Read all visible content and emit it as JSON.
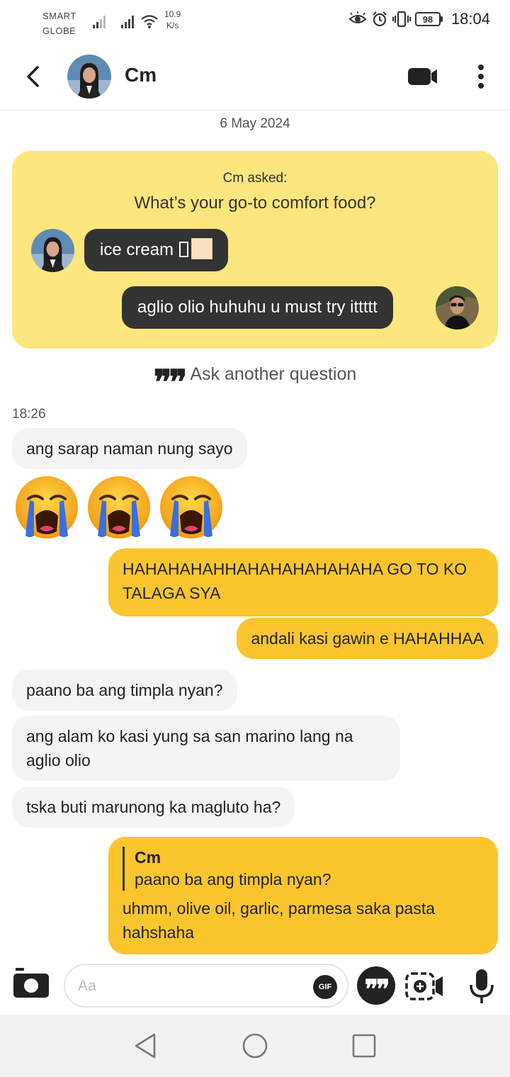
{
  "status_bar": {
    "carrier_line1": "SMART",
    "carrier_line2": "GLOBE",
    "net_speed_value": "10.9",
    "net_speed_unit": "K/s",
    "battery": "98",
    "time": "18:04"
  },
  "header": {
    "contact_name": "Cm"
  },
  "chat": {
    "date": "6 May 2024",
    "question_card": {
      "asked_by": "Cm asked:",
      "question": "What’s your go-to comfort food?",
      "their_answer": "ice cream",
      "my_answer": "aglio olio huhuhu u must try ittttt"
    },
    "ask_another": "Ask another question",
    "time_label": "18:26",
    "messages": [
      {
        "text": "ang sarap naman nung sayo"
      },
      {
        "text": "HAHAHAHAHHAHAHAHAHAHAHA GO TO KO TALAGA SYA"
      },
      {
        "text": "andali kasi gawin e HAHAHHAA"
      },
      {
        "text": "paano ba ang timpla nyan?"
      },
      {
        "text": "ang alam ko kasi yung sa san marino lang na aglio olio"
      },
      {
        "text": "tska buti marunong ka magluto ha?"
      },
      {
        "reply_to_name": "Cm",
        "reply_to_text": "paano ba ang timpla nyan?",
        "text": "uhmm, olive oil, garlic, parmesa saka pasta hahshaha"
      }
    ],
    "emoji_count": 3
  },
  "composer": {
    "placeholder": "Aa",
    "gif_label": "GIF"
  },
  "colors": {
    "question_card_bg": "#fde67d",
    "outgoing_bubble": "#fbc52e",
    "incoming_bubble": "#f4f4f4",
    "dark_bubble": "#333333"
  }
}
